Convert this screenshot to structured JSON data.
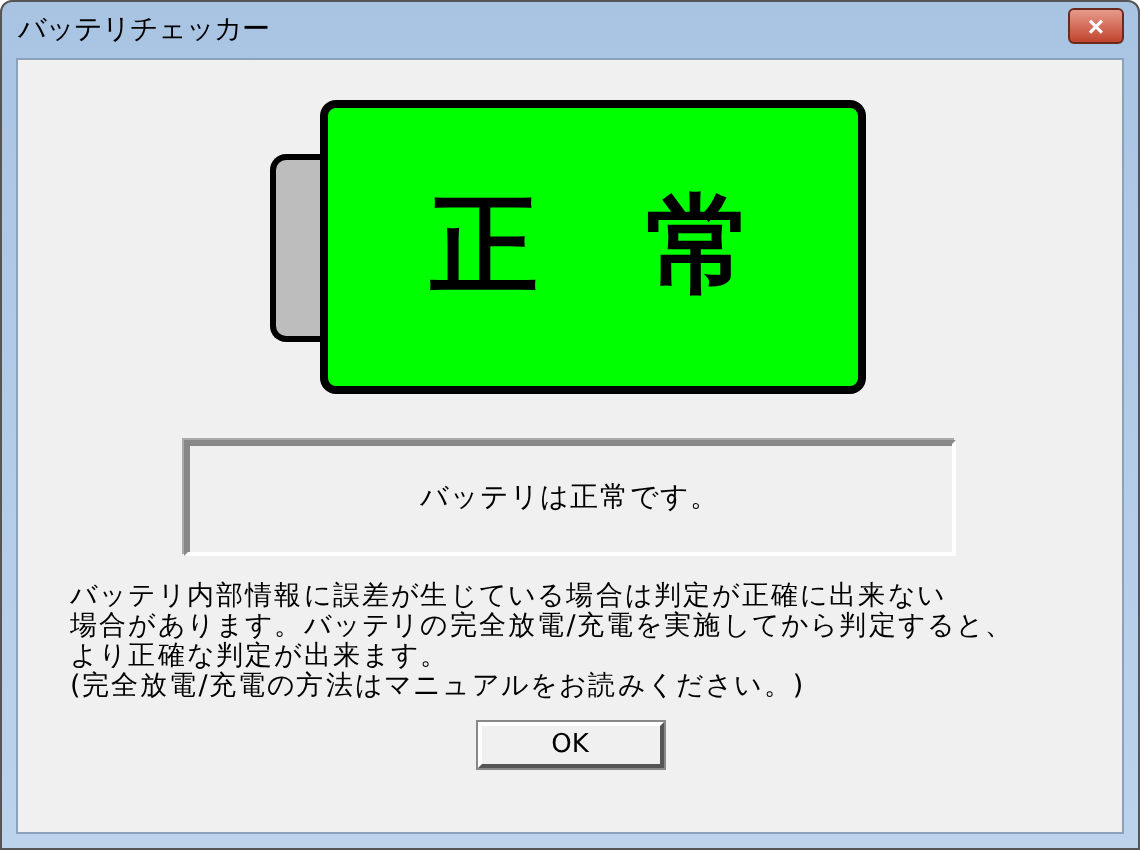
{
  "window": {
    "title": "バッテリチェッカー",
    "close": "×"
  },
  "battery": {
    "label": "正　常"
  },
  "status": {
    "message": "バッテリは正常です。"
  },
  "note": [
    "バッテリ内部情報に誤差が生じている場合は判定が正確に出来ない",
    "場合があります。バッテリの完全放電/充電を実施してから判定すると、",
    "より正確な判定が出来ます。",
    "(完全放電/充電の方法はマニュアルをお読みください。)"
  ],
  "buttons": [
    "OK"
  ]
}
